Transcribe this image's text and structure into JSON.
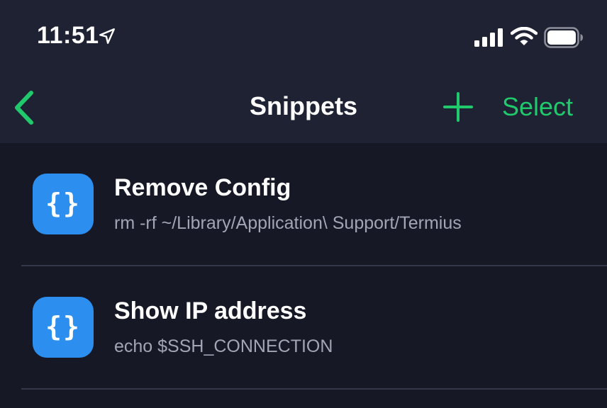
{
  "status_bar": {
    "time": "11:51",
    "location_icon": "location-arrow-icon",
    "signal_icon": "cellular-signal-icon",
    "wifi_icon": "wifi-icon",
    "battery_icon": "battery-icon"
  },
  "nav": {
    "back_icon": "chevron-left-icon",
    "title": "Snippets",
    "add_icon": "plus-icon",
    "select_label": "Select"
  },
  "snippets": [
    {
      "icon": "curly-braces-icon",
      "icon_text": "{}",
      "title": "Remove Config",
      "command": "rm -rf ~/Library/Application\\ Support/Termius"
    },
    {
      "icon": "curly-braces-icon",
      "icon_text": "{}",
      "title": "Show IP address",
      "command": "echo $SSH_CONNECTION"
    }
  ],
  "colors": {
    "accent": "#1fc96c",
    "background": "#161826",
    "header_background": "#1f2233",
    "icon_background": "#2c8ff0",
    "subtitle_text": "#a2a5b4",
    "divider": "#34374a"
  }
}
